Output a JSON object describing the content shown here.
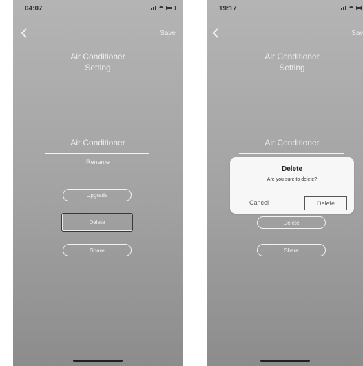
{
  "left": {
    "time": "04:07",
    "save_label": "Save",
    "title": "Air Conditioner\nSetting",
    "device_name": "Air Conditioner",
    "rename_label": "Rename",
    "upgrade_label": "Upgrade",
    "delete_label": "Delete",
    "share_label": "Share"
  },
  "right": {
    "time": "19:17",
    "save_label": "Save",
    "title": "Air Conditioner\nSetting",
    "device_name": "Air Conditioner",
    "delete_label": "Delete",
    "share_label": "Share",
    "dialog": {
      "title": "Delete",
      "message": "Are you sure to delete?",
      "cancel_label": "Cancel",
      "confirm_label": "Delete"
    }
  },
  "icons": {
    "back": "chevron-left-icon",
    "signal": "signal-icon",
    "wifi": "wifi-icon",
    "battery": "battery-icon"
  },
  "colors": {
    "background_top": "#b4b4b4",
    "background_bottom": "#8c8c8c",
    "text_light": "#efefef",
    "dialog_bg": "#f7f7f7"
  }
}
